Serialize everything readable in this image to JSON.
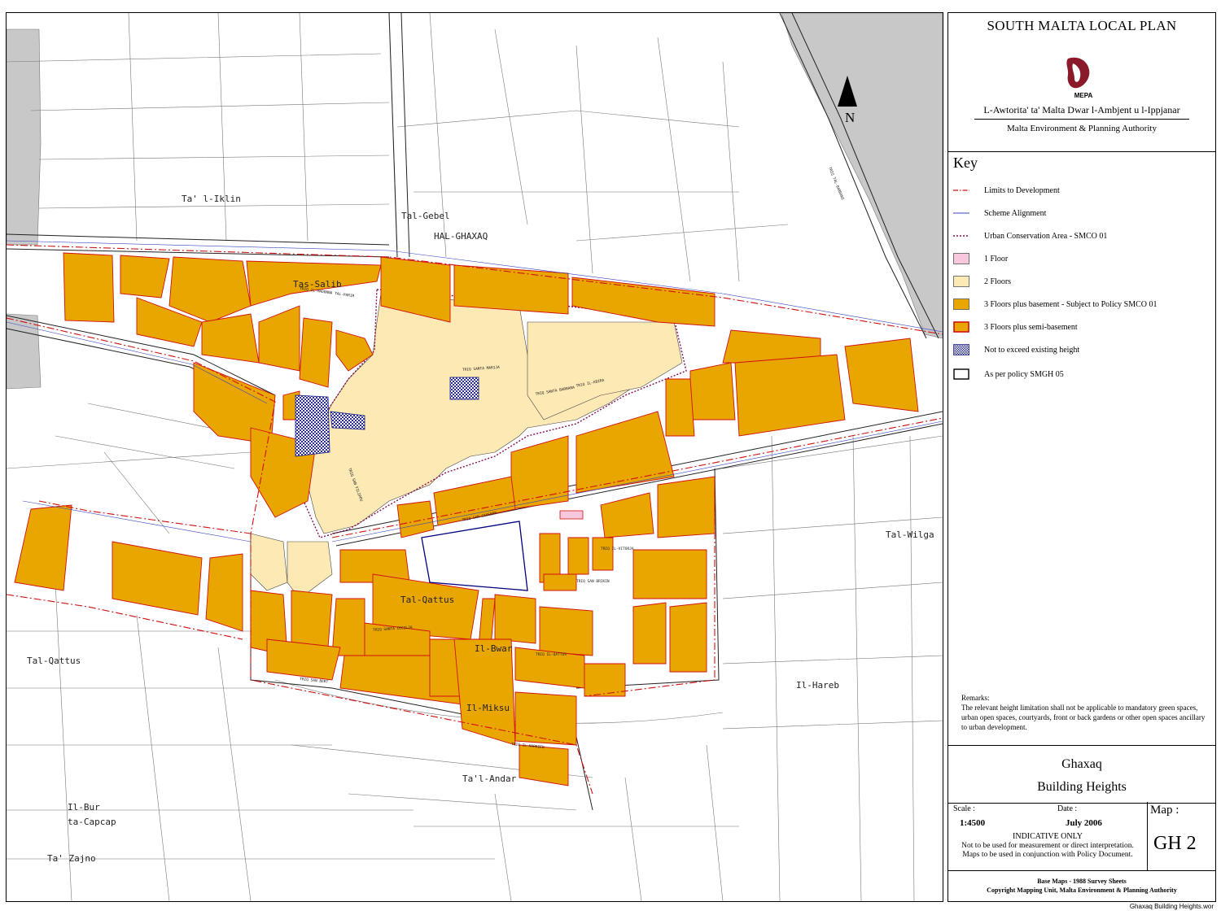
{
  "header": {
    "plan_title": "SOUTH MALTA LOCAL PLAN",
    "logo_text": "MEPA",
    "authority_maltese": "L-Awtorita' ta' Malta Dwar l-Ambjent u l-Ippjanar",
    "authority_english": "Malta Environment & Planning Authority"
  },
  "map": {
    "north_label": "N",
    "places": [
      "Ta' l-Iklin",
      "Tal-Gebel",
      "HAL-GHAXAQ",
      "Tas-Salib",
      "Tal-Qattus",
      "Tal-Qattus",
      "Il-Bwar",
      "Il-Miksu",
      "Tal-Wilga",
      "Il-Hareb",
      "Ta'l-Andar",
      "Il-Bur ta-Capcap",
      "Ta' Zajno"
    ],
    "streets": [
      "TRIQ TAL-BARRANI",
      "TRIQ SANTA MARIJA",
      "TRIQ IL-KBIRA",
      "TRIQ SAN FILIPPU",
      "TRIQ IL-MADONNA TAL-PARIR",
      "TRIQ SAN GIUSEPP",
      "TRIQ SANTA BARBARA",
      "TRIQ IL-VITORJA",
      "TRIQ SAN BRIKIN",
      "TRIQ SANTA CECILJA",
      "TRIQ IL-QATTUS",
      "TRIQ SAN BERT",
      "TRIQ IL-HARRIEB"
    ],
    "colors": {
      "one_floor": "#f7c7dd",
      "two_floors": "#fde9b4",
      "three_floors_basement": "#e9a500",
      "semi_basement_border": "#d01010",
      "existing_height": "#2b2f8f",
      "limits": "#d01010",
      "scheme": "#3545c0",
      "conservation": "#8a0f4f",
      "outside": "#c8c8c8"
    }
  },
  "key": {
    "title": "Key",
    "items": [
      {
        "label": "Limits to Development",
        "symbol": "dash-dot-red-line"
      },
      {
        "label": "Scheme Alignment",
        "symbol": "thin-blue-line"
      },
      {
        "label": "Urban Conservation Area - SMCO 01",
        "symbol": "dotted-purple-line"
      },
      {
        "label": "1 Floor",
        "symbol": "pink-box"
      },
      {
        "label": "2 Floors",
        "symbol": "cream-box"
      },
      {
        "label": "3 Floors plus basement - Subject to Policy SMCO 01",
        "symbol": "orange-box"
      },
      {
        "label": "3 Floors plus semi-basement",
        "symbol": "orange-red-box"
      },
      {
        "label": "Not to exceed existing height",
        "symbol": "blue-checker-box"
      },
      {
        "label": "As per policy SMGH 05",
        "symbol": "black-outline-box"
      }
    ]
  },
  "remarks": {
    "heading": "Remarks:",
    "text": "The relevant height limitation shall not be applicable to mandatory green spaces, urban open spaces, courtyards, front or back gardens or other open spaces ancillary to urban development."
  },
  "title_block": {
    "place": "Ghaxaq",
    "subject": "Building Heights"
  },
  "info": {
    "scale_label": "Scale :",
    "scale_value": "1:4500",
    "date_label": "Date :",
    "date_value": "July 2006",
    "indicative": "INDICATIVE ONLY",
    "note_1": "Not to be used for measurement or direct interpretation.",
    "note_2": "Maps to be used in conjunction with Policy Document.",
    "map_label": "Map :",
    "map_code": "GH 2"
  },
  "base": {
    "line_1": "Base Maps - 1988 Survey Sheets",
    "line_2": "Copyright Mapping Unit, Malta Environment & Planning Authority"
  },
  "file_name": "Ghaxaq Building Heights.wor"
}
